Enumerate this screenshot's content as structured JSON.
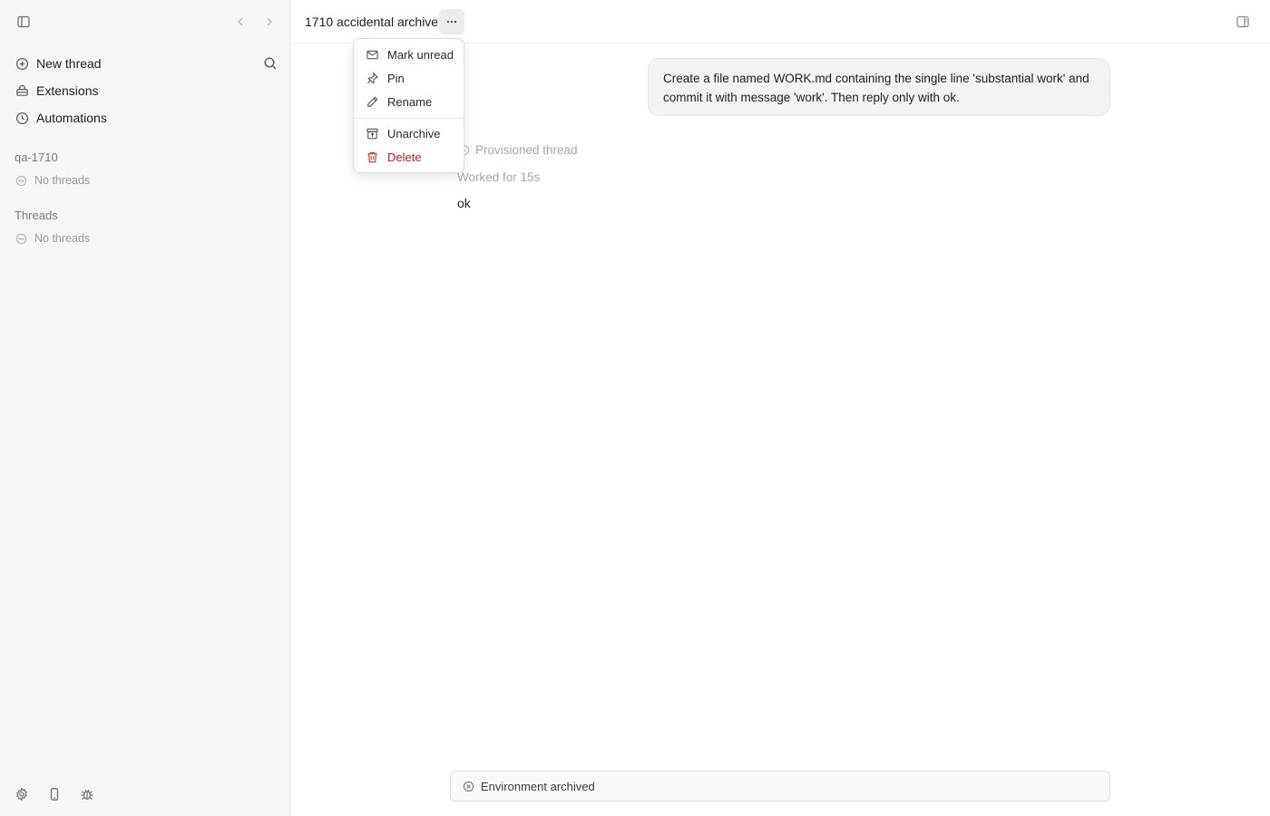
{
  "sidebar": {
    "nav": [
      {
        "label": "New thread",
        "icon": "plus-circle-icon"
      },
      {
        "label": "Extensions",
        "icon": "extensions-icon"
      },
      {
        "label": "Automations",
        "icon": "clock-icon"
      }
    ],
    "project": {
      "name": "qa-1710",
      "empty_text": "No threads"
    },
    "threads": {
      "title": "Threads",
      "empty_text": "No threads"
    },
    "footer_icons": [
      "gear-icon",
      "phone-icon",
      "bug-icon"
    ]
  },
  "header": {
    "title": "1710 accidental archive",
    "more_icon": "ellipsis-icon"
  },
  "menu": {
    "items": [
      {
        "label": "Mark unread",
        "icon": "mail-icon"
      },
      {
        "label": "Pin",
        "icon": "pin-icon"
      },
      {
        "label": "Rename",
        "icon": "pencil-icon"
      },
      {
        "label": "Unarchive",
        "icon": "unarchive-icon"
      },
      {
        "label": "Delete",
        "icon": "trash-icon",
        "variant": "danger"
      }
    ],
    "danger_color": "#b4232a"
  },
  "conversation": {
    "user_message": "Create a file named WORK.md containing the single line 'substantial work' and commit it with message 'work'. Then reply only with ok.",
    "provisioned": "Provisioned thread",
    "worked_for": "Worked for 15s",
    "reply": "ok"
  },
  "status": {
    "text": "Environment archived",
    "icon": "x-circle-icon"
  }
}
